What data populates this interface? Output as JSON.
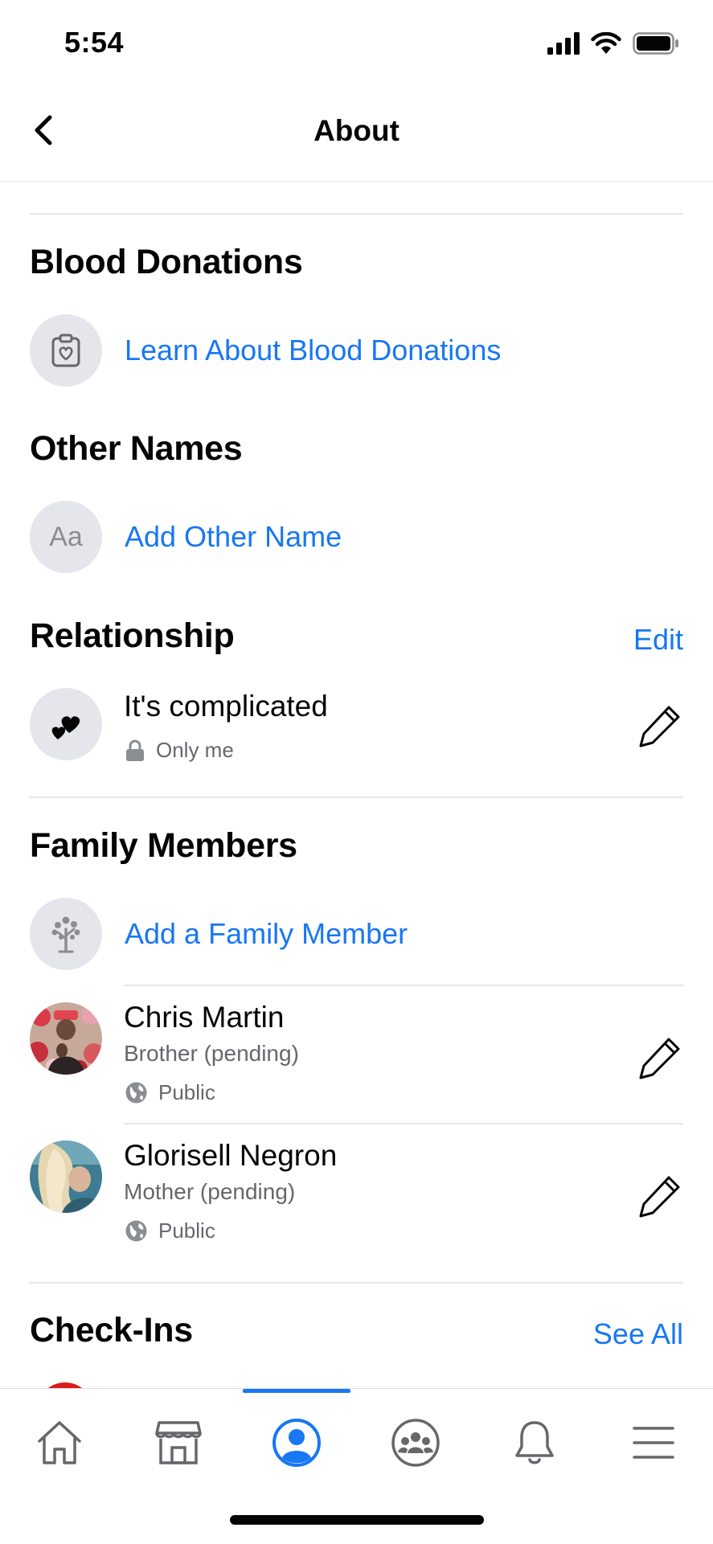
{
  "status_bar": {
    "time": "5:54"
  },
  "nav": {
    "title": "About"
  },
  "sections": {
    "blood_donations": {
      "title": "Blood Donations",
      "action_label": "Learn About Blood Donations"
    },
    "other_names": {
      "title": "Other Names",
      "icon_text": "Aa",
      "action_label": "Add Other Name"
    },
    "relationship": {
      "title": "Relationship",
      "edit_label": "Edit",
      "status": "It's complicated",
      "privacy": "Only me"
    },
    "family_members": {
      "title": "Family Members",
      "add_label": "Add a Family Member",
      "members": [
        {
          "name": "Chris Martin",
          "relation": "Brother (pending)",
          "privacy": "Public"
        },
        {
          "name": "Glorisell Negron",
          "relation": "Mother (pending)",
          "privacy": "Public"
        }
      ]
    },
    "check_ins": {
      "title": "Check-Ins",
      "see_all_label": "See All"
    }
  },
  "tabbar": {
    "tabs": [
      {
        "icon": "home-icon"
      },
      {
        "icon": "marketplace-icon"
      },
      {
        "icon": "profile-icon",
        "active": true
      },
      {
        "icon": "groups-icon"
      },
      {
        "icon": "notifications-icon"
      },
      {
        "icon": "menu-icon"
      }
    ]
  },
  "colors": {
    "accent": "#1877f2",
    "text": "#050505",
    "secondary": "#65676b",
    "icon_bg": "#e4e6eb"
  }
}
